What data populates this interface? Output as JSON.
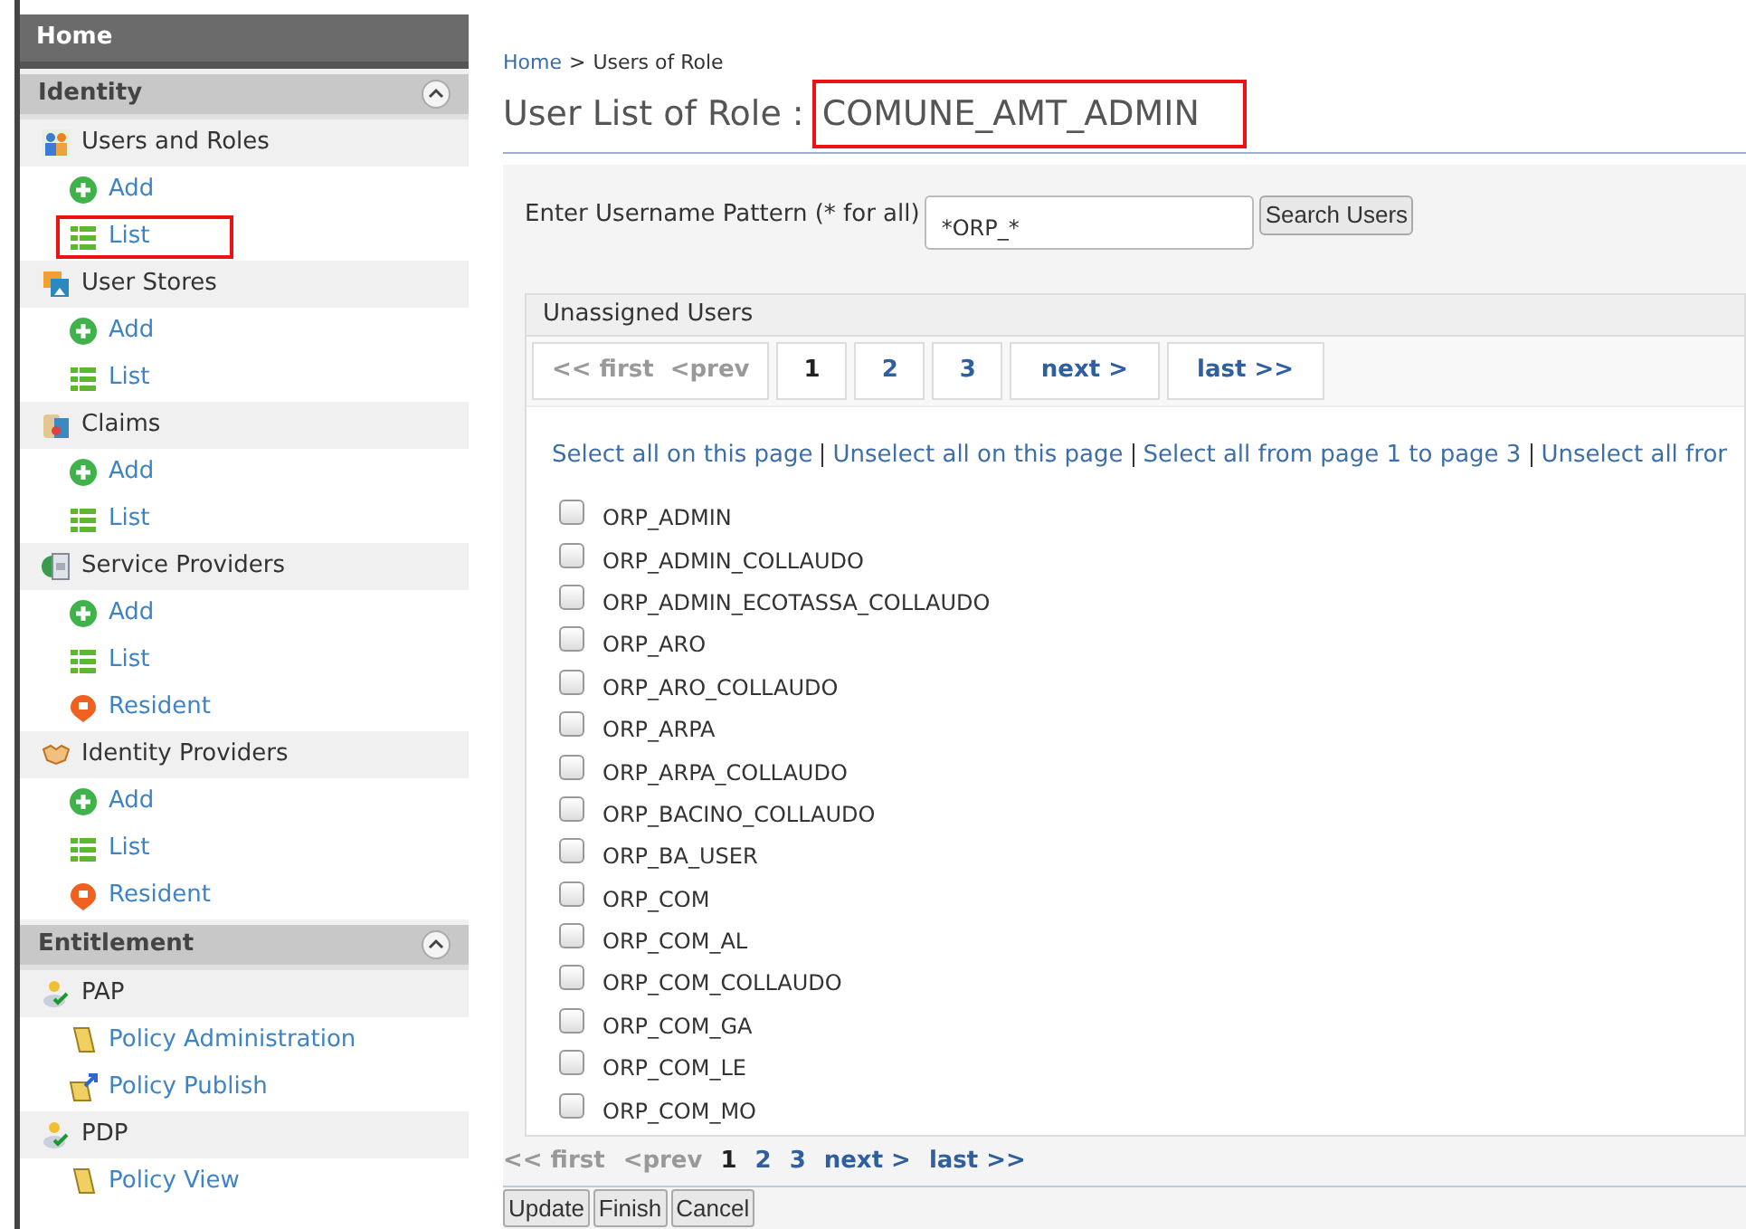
{
  "sidebar": {
    "home": "Home",
    "sections": [
      {
        "title": "Identity",
        "expanded": true,
        "groups": [
          {
            "label": "Users and Roles",
            "kind": "users",
            "children": [
              {
                "label": "Add",
                "kind": "add",
                "highlighted": false
              },
              {
                "label": "List",
                "kind": "list",
                "highlighted": true
              }
            ]
          },
          {
            "label": "User Stores",
            "kind": "stores",
            "children": [
              {
                "label": "Add",
                "kind": "add",
                "highlighted": false
              },
              {
                "label": "List",
                "kind": "list",
                "highlighted": false
              }
            ]
          },
          {
            "label": "Claims",
            "kind": "claims",
            "children": [
              {
                "label": "Add",
                "kind": "add",
                "highlighted": false
              },
              {
                "label": "List",
                "kind": "list",
                "highlighted": false
              }
            ]
          },
          {
            "label": "Service Providers",
            "kind": "service",
            "children": [
              {
                "label": "Add",
                "kind": "add",
                "highlighted": false
              },
              {
                "label": "List",
                "kind": "list",
                "highlighted": false
              },
              {
                "label": "Resident",
                "kind": "resident",
                "highlighted": false
              }
            ]
          },
          {
            "label": "Identity Providers",
            "kind": "handshake",
            "children": [
              {
                "label": "Add",
                "kind": "add",
                "highlighted": false
              },
              {
                "label": "List",
                "kind": "list",
                "highlighted": false
              },
              {
                "label": "Resident",
                "kind": "resident",
                "highlighted": false
              }
            ]
          }
        ]
      },
      {
        "title": "Entitlement",
        "expanded": true,
        "groups": [
          {
            "label": "PAP",
            "kind": "person",
            "children": [
              {
                "label": "Policy Administration",
                "kind": "scroll",
                "highlighted": false
              },
              {
                "label": "Policy Publish",
                "kind": "publish",
                "highlighted": false
              }
            ]
          },
          {
            "label": "PDP",
            "kind": "person",
            "children": [
              {
                "label": "Policy View",
                "kind": "scroll",
                "highlighted": false
              }
            ]
          }
        ]
      }
    ]
  },
  "breadcrumb": {
    "home": "Home",
    "separator": ">",
    "current": "Users of Role"
  },
  "title": {
    "prefix": "User List of Role :",
    "role": "COMUNE_AMT_ADMIN",
    "highlighted": true
  },
  "search": {
    "label": "Enter Username Pattern (* for all)",
    "value": "*ORP_*",
    "button": "Search Users"
  },
  "panel": {
    "title": "Unassigned Users",
    "pager": [
      {
        "label": "<< first  <prev",
        "kind": "disabled",
        "selected": false
      },
      {
        "label": "1",
        "kind": "page",
        "selected": true
      },
      {
        "label": "2",
        "kind": "page",
        "selected": false
      },
      {
        "label": "3",
        "kind": "page",
        "selected": false
      },
      {
        "label": "next >",
        "kind": "nav",
        "selected": false
      },
      {
        "label": "last >>",
        "kind": "nav",
        "selected": false
      }
    ],
    "select_links": [
      "Select all on this page",
      "Unselect all on this page",
      "Select all from page 1 to page 3",
      "Unselect all fror"
    ],
    "users": [
      {
        "name": "ORP_ADMIN",
        "checked": false
      },
      {
        "name": "ORP_ADMIN_COLLAUDO",
        "checked": false
      },
      {
        "name": "ORP_ADMIN_ECOTASSA_COLLAUDO",
        "checked": false
      },
      {
        "name": "ORP_ARO",
        "checked": false
      },
      {
        "name": "ORP_ARO_COLLAUDO",
        "checked": false
      },
      {
        "name": "ORP_ARPA",
        "checked": false
      },
      {
        "name": "ORP_ARPA_COLLAUDO",
        "checked": false
      },
      {
        "name": "ORP_BACINO_COLLAUDO",
        "checked": false
      },
      {
        "name": "ORP_BA_USER",
        "checked": false
      },
      {
        "name": "ORP_COM",
        "checked": false
      },
      {
        "name": "ORP_COM_AL",
        "checked": false
      },
      {
        "name": "ORP_COM_COLLAUDO",
        "checked": false
      },
      {
        "name": "ORP_COM_GA",
        "checked": false
      },
      {
        "name": "ORP_COM_LE",
        "checked": false
      },
      {
        "name": "ORP_COM_MO",
        "checked": false
      }
    ]
  },
  "bottom_pager": [
    {
      "label": "<< first",
      "kind": "disabled",
      "selected": false
    },
    {
      "label": "<prev",
      "kind": "disabled",
      "selected": false
    },
    {
      "label": "1",
      "kind": "page",
      "selected": true
    },
    {
      "label": "2",
      "kind": "page",
      "selected": false
    },
    {
      "label": "3",
      "kind": "page",
      "selected": false
    },
    {
      "label": "next >",
      "kind": "nav",
      "selected": false
    },
    {
      "label": "last >>",
      "kind": "nav",
      "selected": false
    }
  ],
  "buttons": [
    "Update",
    "Finish",
    "Cancel"
  ]
}
